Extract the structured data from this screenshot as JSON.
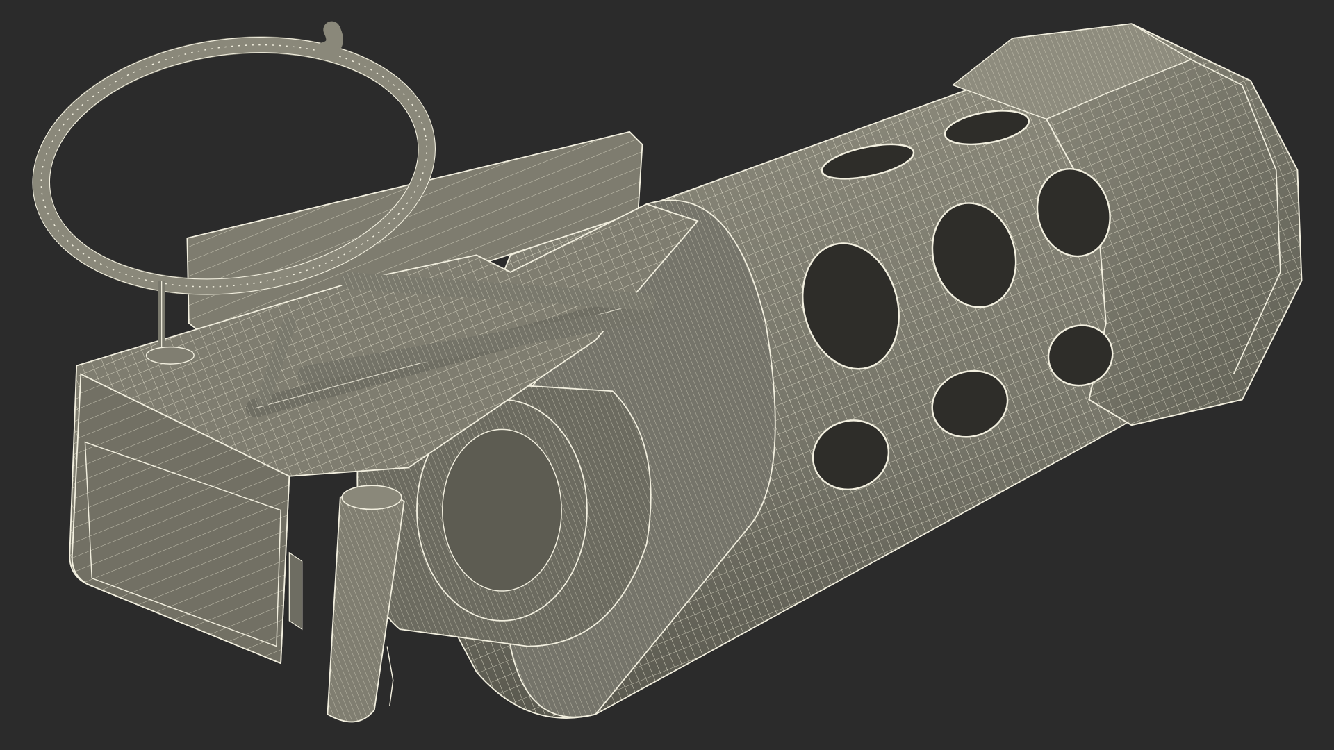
{
  "scene": {
    "subject": "grenade-wireframe-model",
    "background_color": "#2b2b2b",
    "body_color": "#7d7b6d",
    "body_shadow_color": "#57564c",
    "hole_color": "#2e2d29",
    "wire_color": "#f2efdf"
  }
}
